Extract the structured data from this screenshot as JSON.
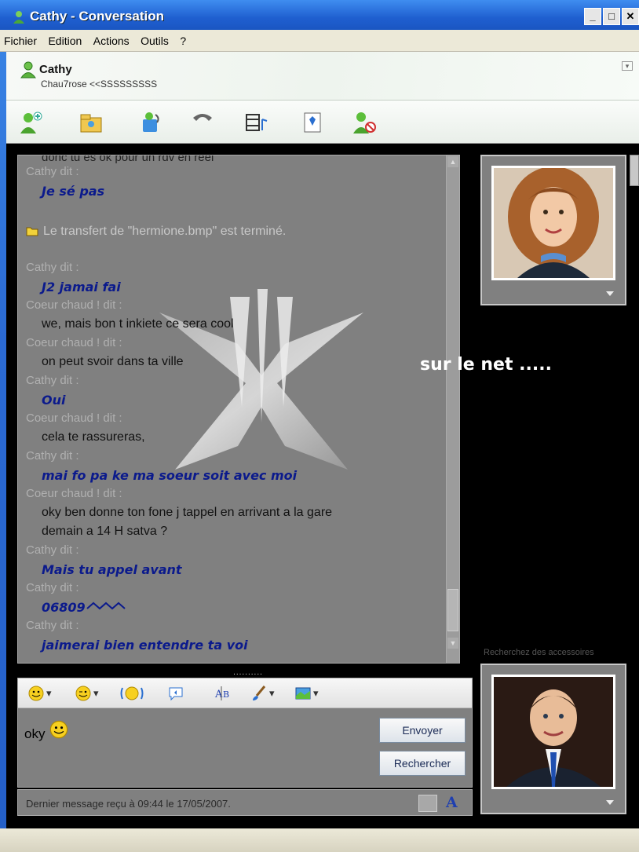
{
  "window": {
    "title": "Cathy - Conversation",
    "controls": [
      "_",
      "□",
      "✕"
    ]
  },
  "menu": [
    "Fichier",
    "Edition",
    "Actions",
    "Outils",
    "?"
  ],
  "contact": {
    "name": "Cathy",
    "subtitle": "Chau7rose <<SSSSSSSSS"
  },
  "toolbar": {
    "icons": [
      "add-contact-icon",
      "share-folder-icon",
      "video-call-icon",
      "phone-icon",
      "media-icon",
      "games-icon",
      "block-icon"
    ]
  },
  "history": {
    "top_cutoff": "donc tu es ok pour un rdv en réel",
    "entries": [
      {
        "head": "Cathy dit :",
        "text": "Je sé pas",
        "who": "cathy"
      },
      {
        "head": "",
        "text": "Le transfert de \"hermione.bmp\" est terminé.",
        "who": "system"
      },
      {
        "head": "Cathy dit :",
        "text": "J2 jamai fai",
        "who": "cathy"
      },
      {
        "head": "Coeur chaud ! dit :",
        "text": "we, mais bon t inkiete ce sera cool",
        "who": "coeur"
      },
      {
        "head": "Coeur chaud ! dit :",
        "text": "on peut svoir dans ta ville",
        "who": "coeur"
      },
      {
        "head": "Cathy dit :",
        "text": "Oui",
        "who": "cathy"
      },
      {
        "head": "Coeur chaud ! dit :",
        "text": "cela te rassureras,",
        "who": "coeur"
      },
      {
        "head": "Cathy dit :",
        "text": "mai fo pa ke ma soeur soit avec moi",
        "who": "cathy"
      },
      {
        "head": "Coeur chaud ! dit :",
        "text": "oky ben donne ton fone j tappel en arrivant a la gare",
        "text2": "demain a 14 H satva ?",
        "who": "coeur"
      },
      {
        "head": "Cathy dit :",
        "text": "Mais tu appel avant",
        "who": "cathy"
      },
      {
        "head": "Cathy dit :",
        "text": "06809",
        "who": "cathy"
      },
      {
        "head": "Cathy dit :",
        "text": "jaimerai bien entendre ta voi",
        "who": "cathy"
      }
    ]
  },
  "overlay_caption": "sur le net .....",
  "splitter": "..........",
  "composer": {
    "text": "oky",
    "send_label": "Envoyer",
    "search_label": "Rechercher"
  },
  "status": {
    "text": "Dernier message reçu à 09:44 le 17/05/2007."
  },
  "accessories_label": "Recherchez des accessoires",
  "colors": {
    "cathy_text": "#0b1a8c",
    "window_blue": "#2b6ad3",
    "panel_gray": "#808080"
  }
}
